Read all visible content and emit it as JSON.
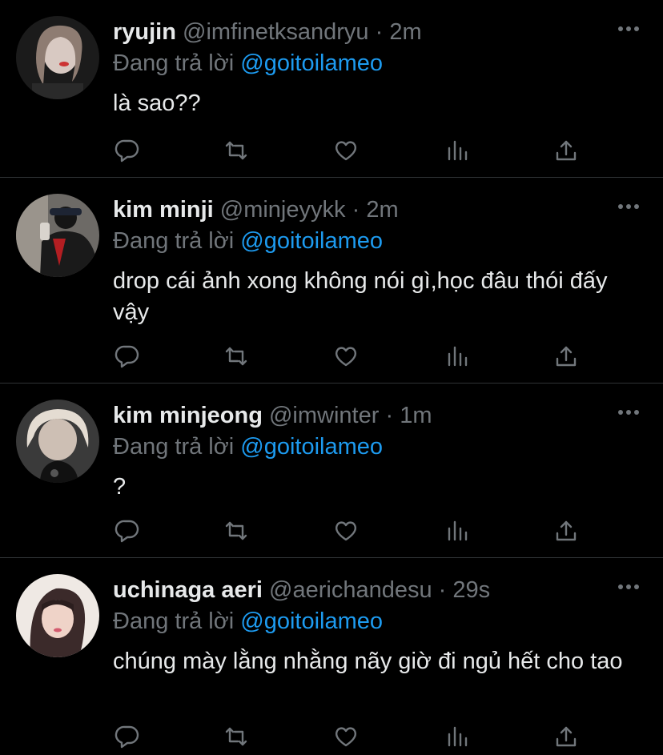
{
  "reply_prefix": "Đang trả lời",
  "tweets": [
    {
      "name": "ryujin",
      "handle": "@imfinetksandryu",
      "separator": "·",
      "time": "2m",
      "reply_to": "@goitoilameo",
      "text": "là sao??"
    },
    {
      "name": "kim minji",
      "handle": "@minjeyykk",
      "separator": "·",
      "time": "2m",
      "reply_to": "@goitoilameo",
      "text": "drop cái ảnh xong không nói gì,học đâu thói đấy vậy"
    },
    {
      "name": "kim minjeong",
      "handle": "@imwinter",
      "separator": "·",
      "time": "1m",
      "reply_to": "@goitoilameo",
      "text": "?"
    },
    {
      "name": "uchinaga aeri",
      "handle": "@aerichandesu",
      "separator": "·",
      "time": "29s",
      "reply_to": "@goitoilameo",
      "text": "chúng mày lằng nhằng nãy giờ đi ngủ hết cho tao"
    }
  ],
  "icons": {
    "more": "more-icon",
    "reply": "reply-icon",
    "retweet": "retweet-icon",
    "like": "like-icon",
    "views": "views-icon",
    "share": "share-icon"
  },
  "colors": {
    "background": "#000000",
    "text": "#e7e9ea",
    "secondary": "#71767b",
    "link": "#1d9bf0",
    "divider": "#2f3336"
  }
}
